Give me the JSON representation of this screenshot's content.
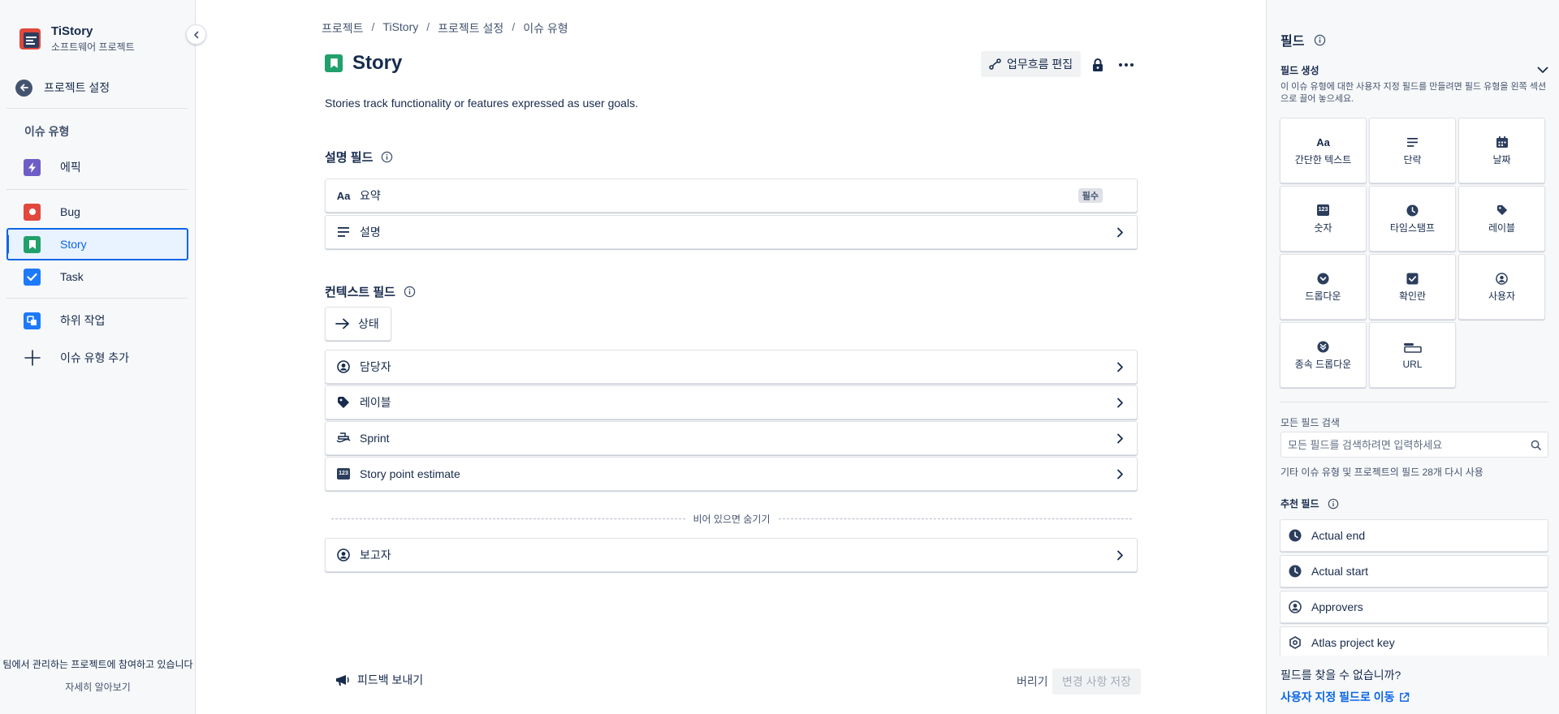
{
  "sidebar": {
    "project_name": "TiStory",
    "project_type": "소프트웨어 프로젝트",
    "back_label": "프로젝트 설정",
    "section_title": "이슈 유형",
    "items": [
      {
        "label": "에픽"
      },
      {
        "label": "Bug"
      },
      {
        "label": "Story"
      },
      {
        "label": "Task"
      },
      {
        "label": "하위 작업"
      },
      {
        "label": "이슈 유형 추가"
      }
    ],
    "footer_text": "팀에서 관리하는 프로젝트에 참여하고 있습니다",
    "footer_link": "자세히 알아보기"
  },
  "breadcrumb": [
    "프로젝트",
    "TiStory",
    "프로젝트 설정",
    "이슈 유형"
  ],
  "header": {
    "title": "Story",
    "workflow_button": "업무흐름 편집",
    "description": "Stories track functionality or features expressed as user goals."
  },
  "description_fields": {
    "title": "설명 필드",
    "fields": [
      {
        "icon_text": "Aa",
        "label": "요약",
        "badge": "필수"
      },
      {
        "label": "설명"
      }
    ]
  },
  "context_fields": {
    "title": "컨텍스트 필드",
    "status_label": "상태",
    "fields": [
      {
        "label": "담당자"
      },
      {
        "label": "레이블"
      },
      {
        "label": "Sprint"
      },
      {
        "icon_text": "123",
        "label": "Story point estimate"
      }
    ],
    "hide_when_empty": "비어 있으면 숨기기",
    "hidden_fields": [
      {
        "label": "보고자"
      }
    ]
  },
  "footer": {
    "feedback": "피드백 보내기",
    "discard": "버리기",
    "save": "변경 사항 저장"
  },
  "right_panel": {
    "title": "필드",
    "create_title": "필드 생성",
    "create_hint": "이 이슈 유형에 대한 사용자 지정 필드를 만들려면 필드 유형을 왼쪽 섹션으로 끌어 놓으세요.",
    "field_types": [
      {
        "icon_text": "Aa",
        "label": "간단한 텍스트"
      },
      {
        "label": "단락"
      },
      {
        "label": "날짜"
      },
      {
        "icon_text": "123",
        "label": "숫자"
      },
      {
        "label": "타임스탬프"
      },
      {
        "label": "레이블"
      },
      {
        "label": "드롭다운"
      },
      {
        "label": "확인란"
      },
      {
        "label": "사용자"
      },
      {
        "label": "종속 드롭다운"
      },
      {
        "label": "URL"
      }
    ],
    "search_label": "모든 필드 검색",
    "search_placeholder": "모든 필드를 검색하려면 입력하세요",
    "reuse_text": "기타 이슈 유형 및 프로젝트의 필드 28개 다시 사용",
    "recommended_title": "추천 필드",
    "recommended": [
      {
        "label": "Actual end"
      },
      {
        "label": "Actual start"
      },
      {
        "label": "Approvers"
      },
      {
        "label": "Atlas project key"
      }
    ],
    "cant_find": "필드를 찾을 수 없습니까?",
    "custom_link": "사용자 지정 필드로 이동"
  },
  "colors": {
    "accent": "#0c66e4",
    "epic": "#6e5dc6",
    "bug": "#e2483d",
    "story": "#22a06b",
    "task": "#1d7afc",
    "subtask": "#1d7afc",
    "icon_dark": "#2c3e5d"
  }
}
